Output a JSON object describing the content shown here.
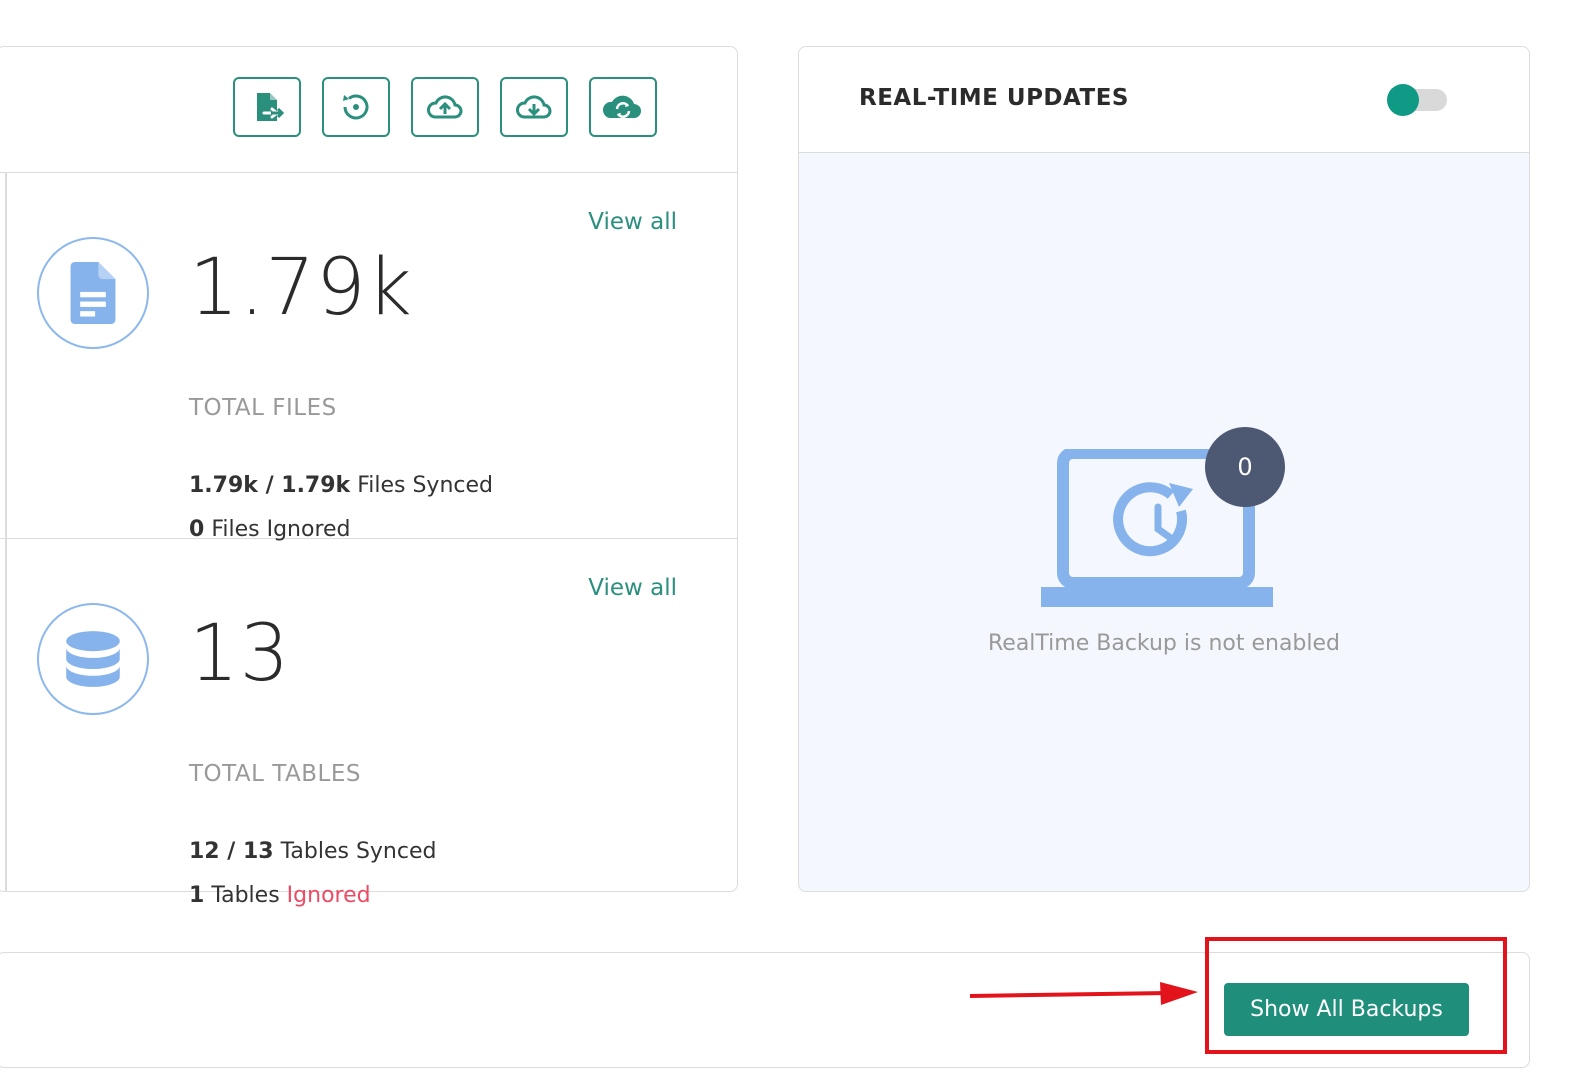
{
  "toolbar": {
    "buttons": [
      {
        "icon": "file-export-icon"
      },
      {
        "icon": "restore-icon"
      },
      {
        "icon": "cloud-upload-icon"
      },
      {
        "icon": "cloud-download-icon"
      },
      {
        "icon": "cloud-sync-icon"
      }
    ]
  },
  "files": {
    "view_all": "View all",
    "total": "1.79k",
    "label": "TOTAL FILES",
    "synced_count": "1.79k / 1.79k",
    "synced_text": "Files Synced",
    "ignored_count": "0",
    "ignored_text": "Files Ignored"
  },
  "tables": {
    "view_all": "View all",
    "total": "13",
    "label": "TOTAL TABLES",
    "synced_count": "12 / 13",
    "synced_text": "Tables Synced",
    "ignored_count": "1",
    "ignored_word": "Tables",
    "ignored_link": "Ignored"
  },
  "realtime": {
    "title": "REAL-TIME UPDATES",
    "toggle_on": false,
    "badge": "0",
    "message": "RealTime Backup is not enabled"
  },
  "bottom": {
    "show_all_label": "Show All Backups"
  },
  "colors": {
    "accent": "#1f8f7c",
    "icon_blue": "#86b3ec",
    "ignored_red": "#ec4b64",
    "badge_bg": "#4d5972",
    "highlight": "#e3131b"
  }
}
